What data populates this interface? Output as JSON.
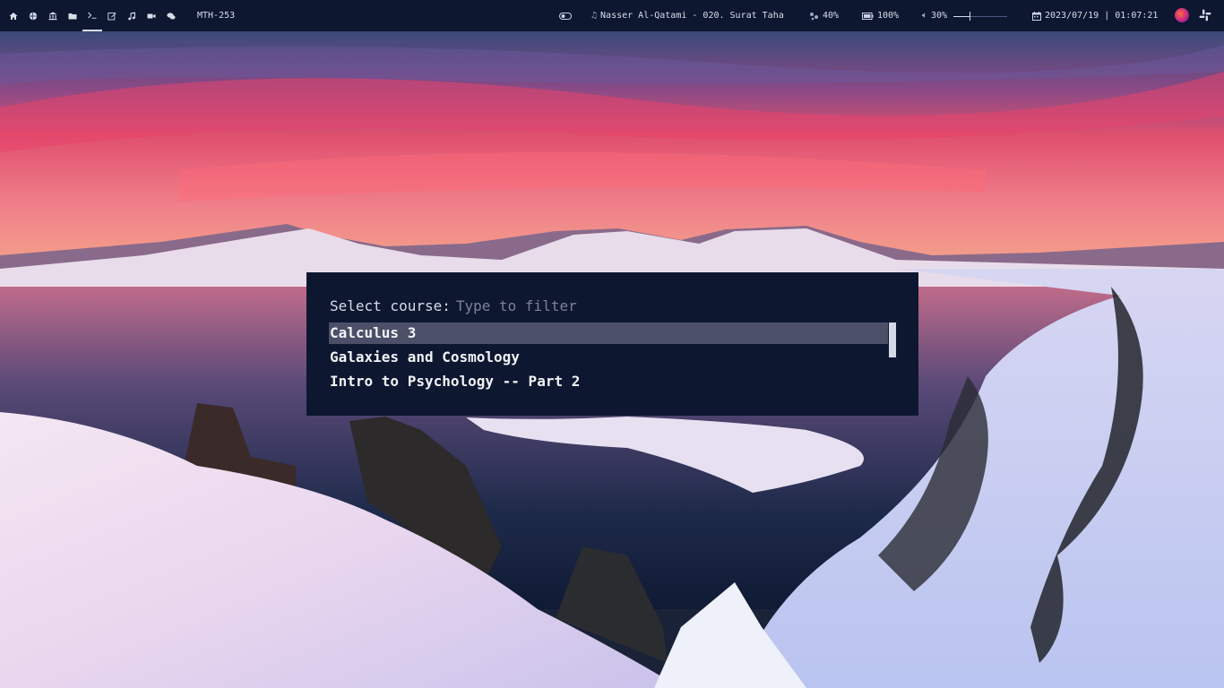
{
  "topbar": {
    "workspaces": [
      {
        "name": "home-icon"
      },
      {
        "name": "globe-icon"
      },
      {
        "name": "bank-icon"
      },
      {
        "name": "folder-icon"
      },
      {
        "name": "terminal-icon",
        "active": true
      },
      {
        "name": "edit-icon"
      },
      {
        "name": "music-icon"
      },
      {
        "name": "video-icon"
      },
      {
        "name": "chat-icon"
      }
    ],
    "project": "MTH-253",
    "now_playing": "Nasser Al-Qatami - 020. Surat Taha",
    "cpu": "40%",
    "battery": "100%",
    "volume": "30%",
    "volume_level": 0.3,
    "datetime": "2023/07/19 | 01:07:21"
  },
  "launcher": {
    "prompt": "Select course:",
    "placeholder": "Type to filter",
    "items": [
      {
        "label": "Calculus 3",
        "selected": true
      },
      {
        "label": "Galaxies and Cosmology"
      },
      {
        "label": "Intro to Psychology -- Part 2"
      }
    ]
  },
  "colors": {
    "bar_bg": "#0d1730",
    "launcher_bg": "#0e1730",
    "selection_bg": "#4b5068"
  }
}
